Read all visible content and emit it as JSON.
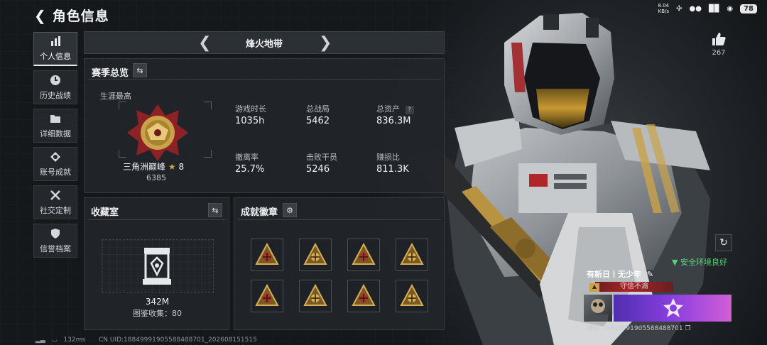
{
  "page": {
    "title": "角色信息"
  },
  "status_bar": {
    "net_speed": "8.04\nKB/s",
    "battery": "78"
  },
  "nav": [
    {
      "label": "个人信息",
      "icon": "bar-chart-icon",
      "active": true
    },
    {
      "label": "历史战绩",
      "icon": "clock-icon"
    },
    {
      "label": "详细数据",
      "icon": "folder-icon"
    },
    {
      "label": "账号成就",
      "icon": "medal-icon"
    },
    {
      "label": "社交定制",
      "icon": "tools-icon"
    },
    {
      "label": "信誉档案",
      "icon": "shield-icon"
    }
  ],
  "map": {
    "name": "烽火地带"
  },
  "season": {
    "title": "赛季总览",
    "career_best_label": "生涯最高",
    "rank_name": "三角洲巅峰",
    "rank_stars": "8",
    "rank_score": "6385",
    "stats": [
      {
        "label": "游戏时长",
        "value": "1035h"
      },
      {
        "label": "总战局",
        "value": "5462"
      },
      {
        "label": "总资产",
        "value": "836.3M",
        "help": "?"
      },
      {
        "label": "撤离率",
        "value": "25.7%"
      },
      {
        "label": "击败干员",
        "value": "5246"
      },
      {
        "label": "赚损比",
        "value": "811.3K"
      }
    ]
  },
  "collection": {
    "title": "收藏室",
    "value": "342M",
    "count_label": "图鉴收集：80"
  },
  "achievements": {
    "title": "成就徽章",
    "badges": [
      "badge-1",
      "badge-2",
      "badge-3",
      "badge-4",
      "badge-5",
      "badge-6",
      "badge-7",
      "badge-8"
    ]
  },
  "likes": {
    "count": "267"
  },
  "safety": {
    "text": "安全环境良好"
  },
  "player": {
    "name": "有新日丨无少年",
    "trust": "守信不渝",
    "uid": "编号:18849991905588488701"
  },
  "footer": {
    "ping": "132ms",
    "uid": "CN UID:18849991905588488701_202608151515"
  },
  "colors": {
    "accent": "#e8ebee",
    "safe": "#58d27a",
    "trust": "#a4262a",
    "gold": "#c9a24a"
  }
}
